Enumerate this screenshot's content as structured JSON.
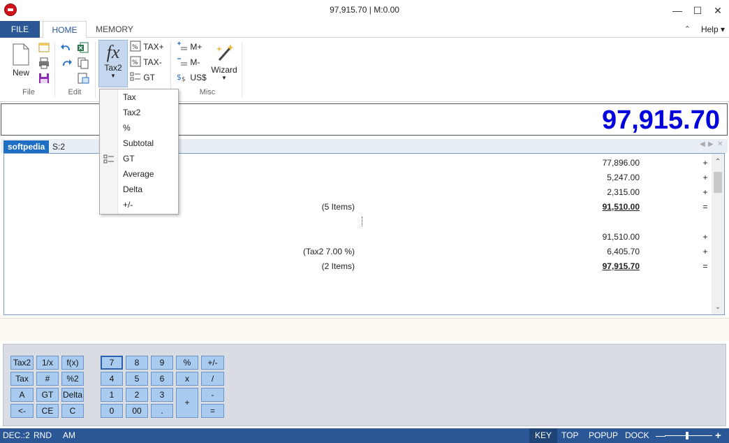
{
  "window": {
    "title": "97,915.70 | M:0.00"
  },
  "tabs": {
    "file": "FILE",
    "home": "HOME",
    "memory": "MEMORY",
    "help": "Help"
  },
  "ribbon": {
    "new_label": "New",
    "file_group": "File",
    "edit_group": "Edit",
    "tax2_label": "Tax2",
    "taxplus_label": "TAX+",
    "taxminus_label": "TAX-",
    "gt_label": "GT",
    "mplus_label": "M+",
    "mminus_label": "M-",
    "uss_label": "US$",
    "wizard_label": "Wizard",
    "misc_group": "Misc"
  },
  "display": {
    "value": "97,915.70"
  },
  "tape_tabs": {
    "active": "softpedia",
    "other": "S:2"
  },
  "tape": {
    "rows": [
      {
        "note": "",
        "value": "77,896.00",
        "op": "+",
        "total": false
      },
      {
        "note": "",
        "value": "5,247.00",
        "op": "+",
        "total": false
      },
      {
        "note": "",
        "value": "2,315.00",
        "op": "+",
        "total": false
      },
      {
        "note": "(5 Items)",
        "value": "91,510.00",
        "op": "=",
        "total": true
      },
      {
        "note": "",
        "value": "91,510.00",
        "op": "+",
        "total": false
      },
      {
        "note": "(Tax2 7.00 %)",
        "value": "6,405.70",
        "op": "+",
        "total": false
      },
      {
        "note": "(2 Items)",
        "value": "97,915.70",
        "op": "=",
        "total": true
      }
    ]
  },
  "menu": {
    "items": [
      "Tax",
      "Tax2",
      "%",
      "Subtotal",
      "GT",
      "Average",
      "Delta",
      "+/-"
    ]
  },
  "keys": {
    "tax2": "Tax2",
    "inv": "1/x",
    "fx": "f(x)",
    "tax": "Tax",
    "hash": "#",
    "pct2": "%2",
    "a": "A",
    "gt": "GT",
    "delta": "Delta",
    "back": "<-",
    "ce": "CE",
    "c": "C",
    "k7": "7",
    "k8": "8",
    "k9": "9",
    "pct": "%",
    "pm": "+/-",
    "k4": "4",
    "k5": "5",
    "k6": "6",
    "mul": "x",
    "div": "/",
    "k1": "1",
    "k2": "2",
    "k3": "3",
    "plus": "+",
    "minus": "-",
    "k0": "0",
    "k00": "00",
    "dot": ".",
    "eq": "="
  },
  "status": {
    "dec": "DEC.:2",
    "rnd": "RND",
    "am": "AM",
    "key": "KEY",
    "top": "TOP",
    "popup": "POPUP",
    "dock": "DOCK"
  },
  "colors": {
    "accent": "#2b5797",
    "display": "#0000dd",
    "key": "#a9cbf0"
  }
}
